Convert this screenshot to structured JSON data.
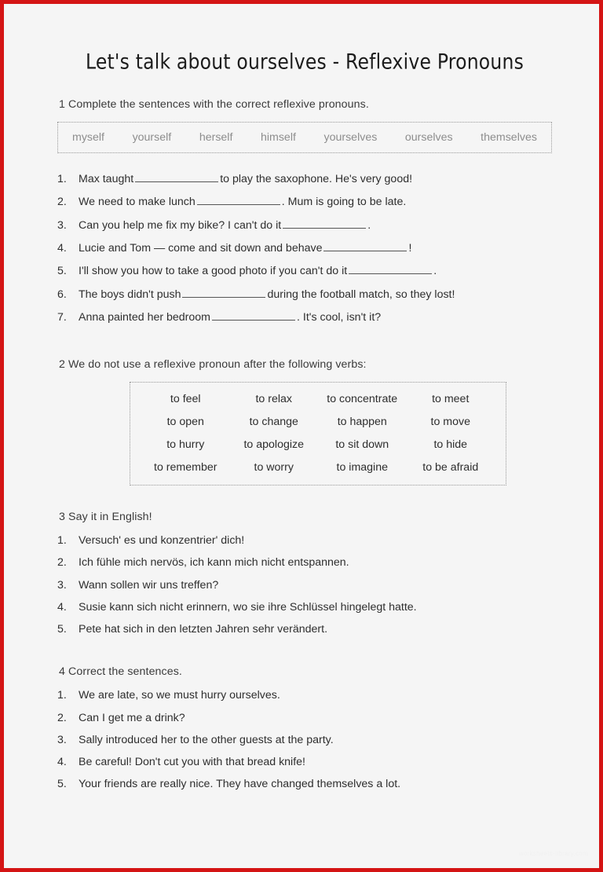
{
  "page": {
    "title": "Let's talk about ourselves - Reflexive Pronouns",
    "border_color": "#d41414",
    "background_color": "#f5f5f5",
    "watermark": "worksheets-library.com"
  },
  "exercise1": {
    "heading": "1 Complete the sentences with the correct reflexive pronouns.",
    "word_bank": [
      "myself",
      "yourself",
      "herself",
      "himself",
      "yourselves",
      "ourselves",
      "themselves"
    ],
    "items": [
      {
        "num": "1.",
        "before": "Max taught",
        "after": "to play the saxophone. He's very good!"
      },
      {
        "num": "2.",
        "before": "We need to make lunch",
        "after": ". Mum is going to be late."
      },
      {
        "num": "3.",
        "before": "Can you help me fix my bike? I can't do it",
        "after": "."
      },
      {
        "num": "4.",
        "before": "Lucie and Tom — come and sit down and behave",
        "after": "!"
      },
      {
        "num": "5.",
        "before": "I'll show you how to take a good photo if you can't do it",
        "after": "."
      },
      {
        "num": "6.",
        "before": "The boys didn't push",
        "after": "during the football match, so they lost!"
      },
      {
        "num": "7.",
        "before": "Anna painted her bedroom",
        "after": ". It's cool, isn't it?"
      }
    ]
  },
  "exercise2": {
    "heading": "2 We do not use a reflexive pronoun after the following verbs:",
    "verb_rows": [
      [
        "to feel",
        "to relax",
        "to concentrate",
        "to meet"
      ],
      [
        "to open",
        "to change",
        "to happen",
        "to move"
      ],
      [
        "to hurry",
        "to apologize",
        "to sit down",
        "to hide"
      ],
      [
        "to remember",
        "to worry",
        "to imagine",
        "to be afraid"
      ]
    ]
  },
  "exercise3": {
    "heading": "3 Say it in English!",
    "items": [
      {
        "num": "1.",
        "text": "Versuch' es und konzentrier' dich!"
      },
      {
        "num": "2.",
        "text": "Ich fühle mich nervös, ich kann mich nicht entspannen."
      },
      {
        "num": "3.",
        "text": "Wann sollen wir uns treffen?"
      },
      {
        "num": "4.",
        "text": "Susie kann sich nicht erinnern, wo sie ihre Schlüssel hingelegt hatte."
      },
      {
        "num": "5.",
        "text": "Pete hat sich in den letzten Jahren sehr verändert."
      }
    ]
  },
  "exercise4": {
    "heading": "4 Correct the sentences.",
    "items": [
      {
        "num": "1.",
        "text": "We are late, so we must hurry ourselves."
      },
      {
        "num": "2.",
        "text": "Can I get me a drink?"
      },
      {
        "num": "3.",
        "text": "Sally introduced her to the other guests at the party."
      },
      {
        "num": "4.",
        "text": "Be careful! Don't cut you with that bread knife!"
      },
      {
        "num": "5.",
        "text": "Your friends are really nice. They have changed themselves a lot."
      }
    ]
  }
}
